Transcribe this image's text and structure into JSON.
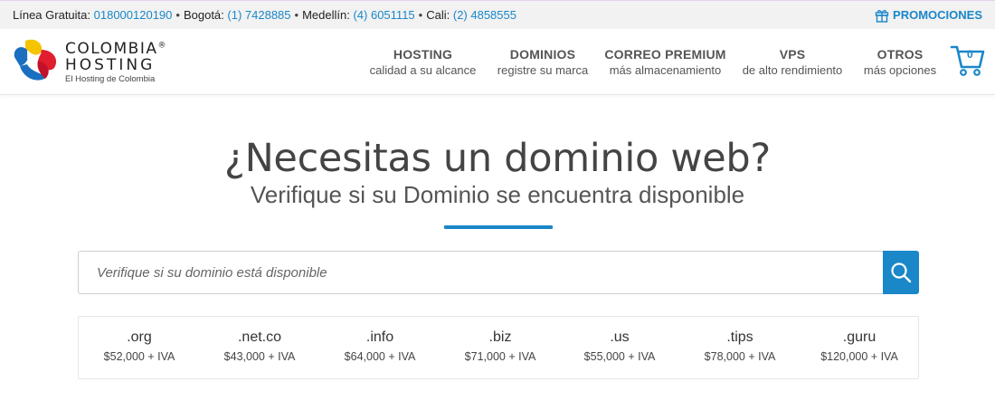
{
  "topbar": {
    "contacts": [
      {
        "label": "Línea Gratuita:",
        "number": "018000120190"
      },
      {
        "label": "Bogotá:",
        "number": "(1) 7428885"
      },
      {
        "label": "Medellín:",
        "number": "(4) 6051115"
      },
      {
        "label": "Cali:",
        "number": "(2) 4858555"
      }
    ],
    "separator": "•",
    "promo_label": "PROMOCIONES"
  },
  "logo": {
    "line1": "COLOMBIA",
    "mark": "®",
    "line2": "HOSTING",
    "tagline": "El Hosting de Colombia"
  },
  "nav": [
    {
      "title": "HOSTING",
      "subtitle": "calidad a su alcance"
    },
    {
      "title": "DOMINIOS",
      "subtitle": "registre su marca"
    },
    {
      "title": "CORREO PREMIUM",
      "subtitle": "más almacenamiento"
    },
    {
      "title": "VPS",
      "subtitle": "de alto rendimiento"
    },
    {
      "title": "OTROS",
      "subtitle": "más opciones"
    }
  ],
  "cart": {
    "count": "0",
    "icon": "cart-icon"
  },
  "hero": {
    "title": "¿Necesitas un dominio web?",
    "subtitle": "Verifique si su Dominio se encuentra disponible"
  },
  "search": {
    "placeholder": "Verifique si su dominio está disponible",
    "value": "",
    "icon": "search-icon"
  },
  "tlds": [
    {
      "name": ".org",
      "price": "$52,000 + IVA"
    },
    {
      "name": ".net.co",
      "price": "$43,000 + IVA"
    },
    {
      "name": ".info",
      "price": "$64,000 + IVA"
    },
    {
      "name": ".biz",
      "price": "$71,000 + IVA"
    },
    {
      "name": ".us",
      "price": "$55,000 + IVA"
    },
    {
      "name": ".tips",
      "price": "$78,000 + IVA"
    },
    {
      "name": ".guru",
      "price": "$120,000 + IVA"
    }
  ],
  "colors": {
    "accent": "#1a87c9",
    "topbar_bg": "#f2f2f2",
    "text": "#333333"
  }
}
